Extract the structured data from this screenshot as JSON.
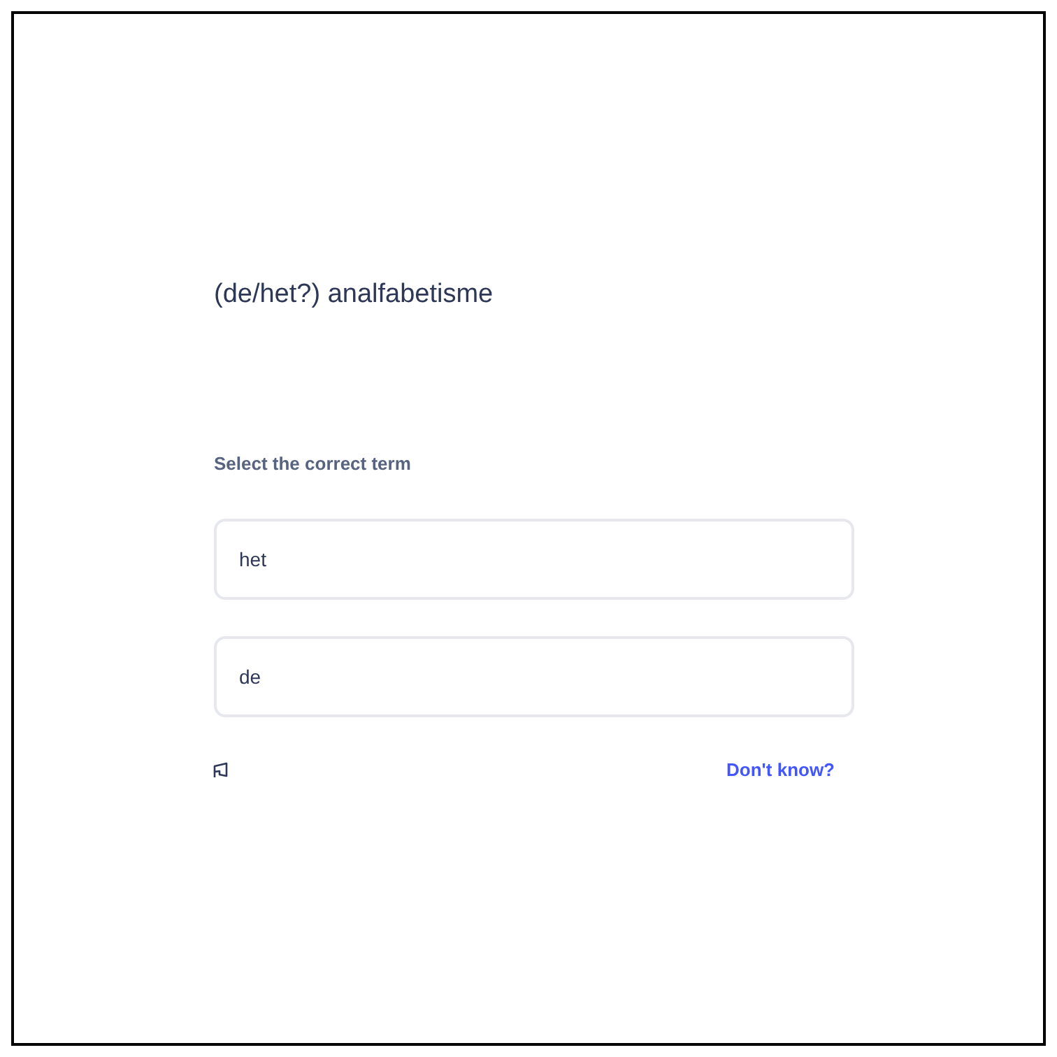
{
  "question": "(de/het?) analfabetisme",
  "prompt": "Select the correct term",
  "options": [
    {
      "label": "het",
      "selected": false
    },
    {
      "label": "de",
      "selected": false
    }
  ],
  "dont_know_link": "Don't know?"
}
